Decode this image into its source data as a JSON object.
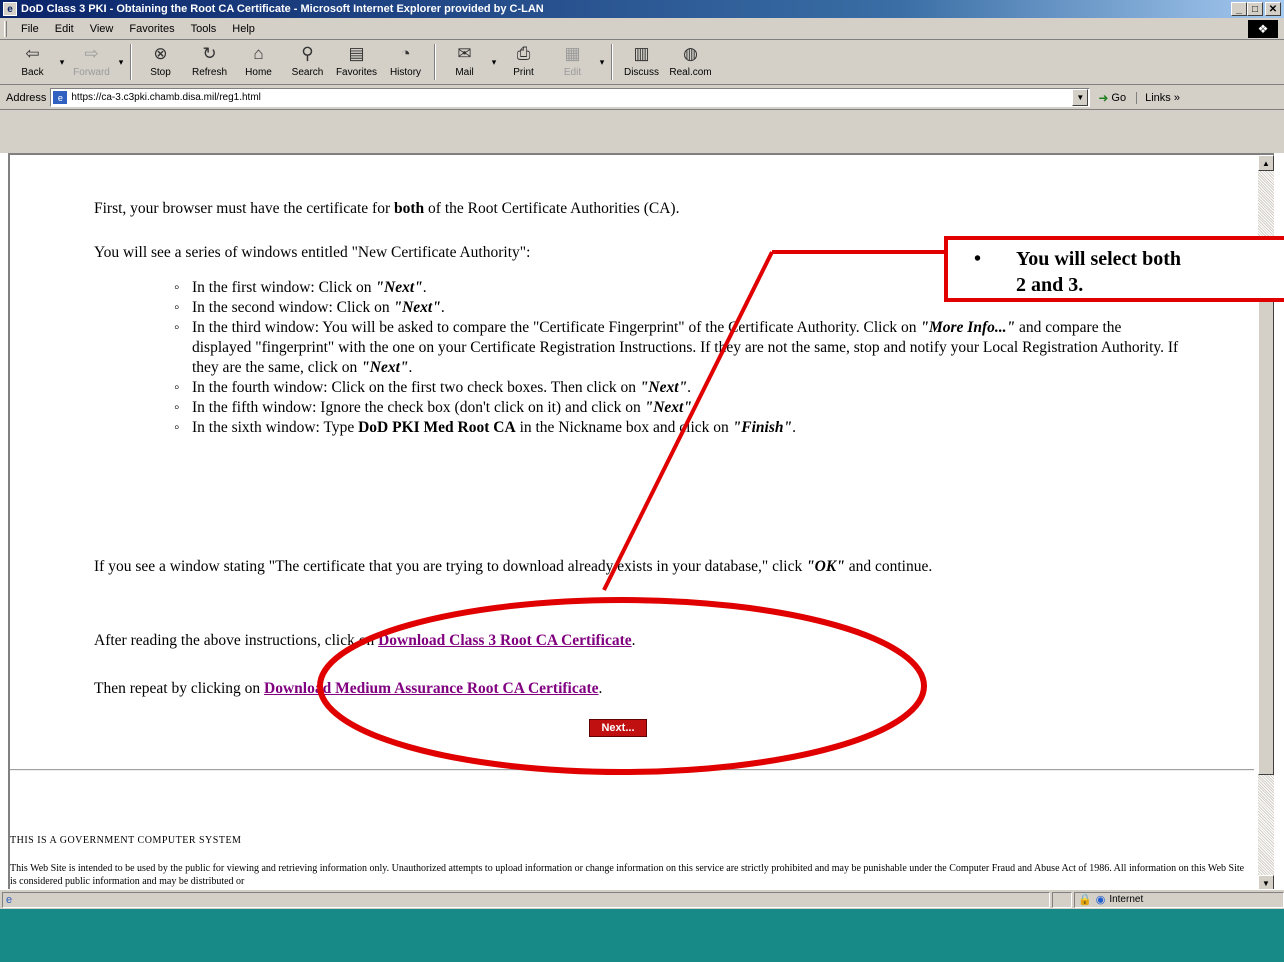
{
  "window": {
    "title": "DoD Class 3 PKI - Obtaining the Root CA Certificate - Microsoft Internet Explorer provided by C-LAN",
    "buttons": {
      "minimize": "_",
      "maximize": "□",
      "close": "✕"
    }
  },
  "menu": [
    "File",
    "Edit",
    "View",
    "Favorites",
    "Tools",
    "Help"
  ],
  "toolbar": [
    {
      "label": "Back",
      "icon": "back-arrow-icon",
      "glyph": "⇦",
      "disabled": false,
      "dropdown": true
    },
    {
      "label": "Forward",
      "icon": "forward-arrow-icon",
      "glyph": "⇨",
      "disabled": true,
      "dropdown": true
    },
    {
      "label": "Stop",
      "icon": "stop-icon",
      "glyph": "⊗",
      "disabled": false,
      "dropdown": false
    },
    {
      "label": "Refresh",
      "icon": "refresh-icon",
      "glyph": "↻",
      "disabled": false,
      "dropdown": false
    },
    {
      "label": "Home",
      "icon": "home-icon",
      "glyph": "⌂",
      "disabled": false,
      "dropdown": false
    },
    {
      "label": "Search",
      "icon": "search-icon",
      "glyph": "⚲",
      "disabled": false,
      "dropdown": false
    },
    {
      "label": "Favorites",
      "icon": "favorites-icon",
      "glyph": "▤",
      "disabled": false,
      "dropdown": false
    },
    {
      "label": "History",
      "icon": "history-icon",
      "glyph": "◔",
      "disabled": false,
      "dropdown": false
    },
    {
      "label": "Mail",
      "icon": "mail-icon",
      "glyph": "✉",
      "disabled": false,
      "dropdown": true
    },
    {
      "label": "Print",
      "icon": "print-icon",
      "glyph": "⎙",
      "disabled": false,
      "dropdown": false
    },
    {
      "label": "Edit",
      "icon": "edit-icon",
      "glyph": "▦",
      "disabled": true,
      "dropdown": true
    },
    {
      "label": "Discuss",
      "icon": "discuss-icon",
      "glyph": "▥",
      "disabled": false,
      "dropdown": false
    },
    {
      "label": "Real.com",
      "icon": "real-icon",
      "glyph": "◍",
      "disabled": false,
      "dropdown": false
    }
  ],
  "address": {
    "label": "Address",
    "url": "https://ca-3.c3pki.chamb.disa.mil/reg1.html",
    "go_label": "Go",
    "links_label": "Links »"
  },
  "content": {
    "intro_pre": "First, your browser must have the certificate for ",
    "intro_bold": "both",
    "intro_post": " of the Root Certificate Authorities (CA).",
    "series": "You will see a series of windows entitled \"New Certificate Authority\":",
    "steps": {
      "s1_pre": "In the first window:  Click on ",
      "s1_em": "\"Next\"",
      "s1_post": ".",
      "s2_pre": "In the second window:  Click on ",
      "s2_em": "\"Next\"",
      "s2_post": ".",
      "s3_pre": "In the third window:  You will be asked to compare the \"Certificate Fingerprint\" of the Certificate Authority. Click on ",
      "s3_em": "\"More Info...\"",
      "s3_mid": " and compare the displayed \"fingerprint\" with the one on your Certificate Registration Instructions. If they are not the same, stop and notify your Local Registration Authority. If they are the same, click on ",
      "s3_em2": "\"Next\"",
      "s3_post": ".",
      "s4_pre": "In the fourth window:  Click on the first two check boxes. Then click on ",
      "s4_em": "\"Next\"",
      "s4_post": ".",
      "s5_pre": "In the fifth window:  Ignore the check box (don't click on it) and click on ",
      "s5_em": "\"Next\"",
      "s5_post": ".",
      "s6_pre": "In the sixth window:  Type ",
      "s6_bold": "DoD PKI Med Root CA",
      "s6_mid": " in the Nickname box and click on ",
      "s6_em": "\"Finish\"",
      "s6_post": "."
    },
    "exists_pre": "If you see a window stating \"The certificate that you are trying to download already exists in your database,\" click ",
    "exists_em": "\"OK\"",
    "exists_post": " and continue.",
    "after_pre": "After reading the above instructions, click on ",
    "link_class3": "Download Class 3 Root CA Certificate",
    "after_post": ".",
    "repeat_pre": "Then repeat by clicking on ",
    "link_medium": "Download Medium Assurance Root CA Certificate",
    "repeat_post": ".",
    "next_button": "Next...",
    "gov_title": "THIS IS A GOVERNMENT COMPUTER SYSTEM",
    "gov_text": "This Web Site is intended to be used by the public for viewing and retrieving information only. Unauthorized attempts to upload information or change information on this service are strictly prohibited and may be punishable under the Computer Fraud and Abuse Act of 1986. All information on this Web Site is considered public information and may be distributed or"
  },
  "callout": {
    "bullet": "•",
    "line1": "You will select both",
    "line2": "2 and 3.",
    "color": "#e00000"
  },
  "status": {
    "zone": "Internet"
  },
  "colors": {
    "titlebar": "#0a246a",
    "link_visited": "#800080",
    "next_button": "#c01010",
    "taskbar": "#178a88",
    "annotation": "#e00000"
  }
}
